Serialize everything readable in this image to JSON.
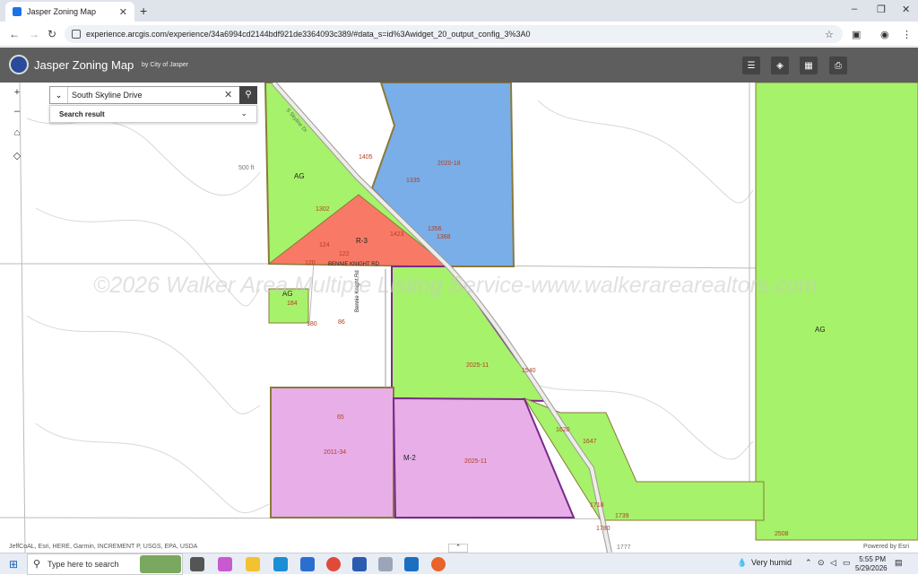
{
  "browser": {
    "tab_title": "Jasper Zoning Map",
    "tab_close": "✕",
    "new_tab": "+",
    "url": "experience.arcgis.com/experience/34a6994cd2144bdf921de3364093c389/#data_s=id%3Awidget_20_output_config_3%3A0",
    "window_controls": [
      "–",
      "❐",
      "✕"
    ]
  },
  "app": {
    "title": "Jasper Zoning Map",
    "by_line": "by City of Jasper",
    "header_buttons": [
      "legend-icon",
      "layers-icon",
      "basemap-gallery-icon",
      "print-icon"
    ]
  },
  "search": {
    "value": "South Skyline Drive",
    "result_label": "Search result"
  },
  "map": {
    "zoom_in": "+",
    "zoom_out": "–",
    "watermark": "©2026 Walker Area Multiple Listing Service-www.walkerarearealtors.com",
    "attribution": "JeffCoAL, Esri, HERE, Garmin, INCREMENT P, USGS, EPA, USDA",
    "powered_by": "Powered by Esri",
    "zone_labels": [
      "AG",
      "R-3",
      "AG",
      "AG",
      "M-2"
    ],
    "parcel_labels": [
      "500 ft",
      "1302",
      "124",
      "122",
      "120",
      "1335",
      "2020-18",
      "1405",
      "1356",
      "1368",
      "1423",
      "184",
      "180",
      "86",
      "2025-11",
      "1540",
      "65",
      "2011-34",
      "2025-11",
      "1620",
      "1647",
      "1718",
      "1739",
      "1780",
      "2508",
      "1777"
    ],
    "road_labels": [
      "BENNIE KNIGHT RD",
      "Bennie Knight Rd",
      "S Skyline Dr"
    ],
    "colors": {
      "ag": "#a6f26a",
      "r3": "#f87a66",
      "blue": "#7aaee8",
      "m2": "#e8aee8",
      "ag_border": "#8a7a3a",
      "m2_border": "#7a2a8a"
    }
  },
  "taskbar": {
    "search_placeholder": "Type here to search",
    "weather": "Very humid",
    "time": "5:55 PM",
    "date": "5/29/2026"
  }
}
